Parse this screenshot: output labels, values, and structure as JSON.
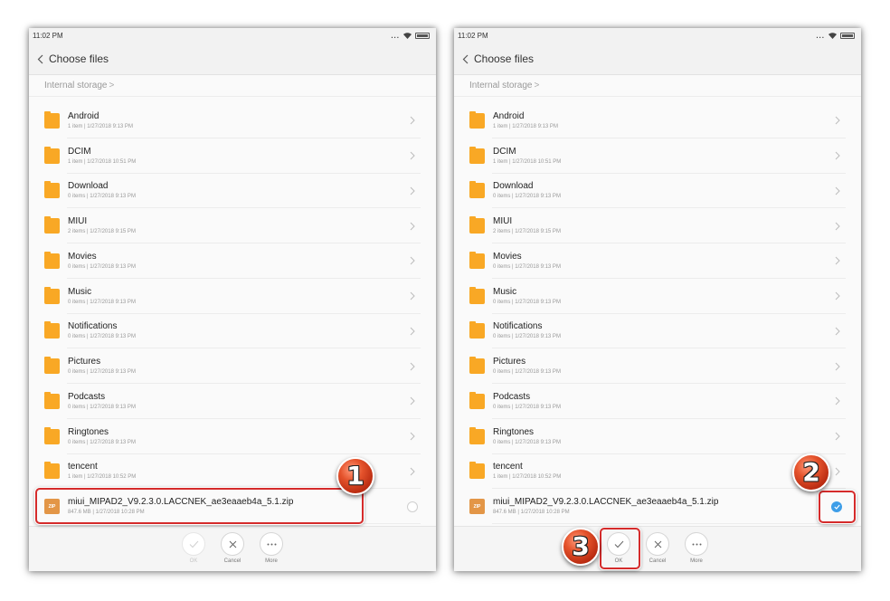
{
  "status": {
    "time": "11:02 PM",
    "dots": "..."
  },
  "header": {
    "title": "Choose files"
  },
  "breadcrumb": {
    "label": "Internal storage",
    "arrow": ">"
  },
  "folders": [
    {
      "name": "Android",
      "meta": "1 item | 1/27/2018 9:13 PM"
    },
    {
      "name": "DCIM",
      "meta": "1 item | 1/27/2018 10:51 PM"
    },
    {
      "name": "Download",
      "meta": "0 items | 1/27/2018 9:13 PM"
    },
    {
      "name": "MIUI",
      "meta": "2 items | 1/27/2018 9:15 PM"
    },
    {
      "name": "Movies",
      "meta": "0 items | 1/27/2018 9:13 PM"
    },
    {
      "name": "Music",
      "meta": "0 items | 1/27/2018 9:13 PM"
    },
    {
      "name": "Notifications",
      "meta": "0 items | 1/27/2018 9:13 PM"
    },
    {
      "name": "Pictures",
      "meta": "0 items | 1/27/2018 9:13 PM"
    },
    {
      "name": "Podcasts",
      "meta": "0 items | 1/27/2018 9:13 PM"
    },
    {
      "name": "Ringtones",
      "meta": "0 items | 1/27/2018 9:13 PM"
    },
    {
      "name": "tencent",
      "meta": "1 item | 1/27/2018 10:52 PM"
    }
  ],
  "zipfile": {
    "name": "miui_MIPAD2_V9.2.3.0.LACCNEK_ae3eaaeb4a_5.1.zip",
    "meta": "847.6 MB | 1/27/2018 10:28 PM",
    "badge": "ZIP"
  },
  "actions": {
    "ok": "OK",
    "cancel": "Cancel",
    "more": "More"
  },
  "annotations": {
    "step1": "1",
    "step2": "2",
    "step3": "3"
  },
  "colors": {
    "folder": "#f9a825",
    "zip": "#e39647",
    "check": "#3e9ee8",
    "highlight": "#d52b2b"
  }
}
